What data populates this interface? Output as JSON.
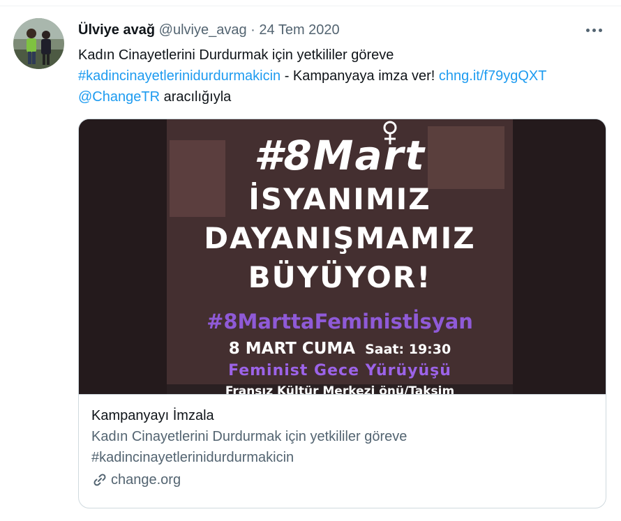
{
  "tweet": {
    "author_name": "Ülviye avağ",
    "handle": "@ulviye_avag",
    "separator": "·",
    "date": "24 Tem 2020",
    "text_line1": "Kadın Cinayetlerini Durdurmak için yetkililer göreve",
    "hashtag": "#kadincinayetlerinidurdurmakicin",
    "text_mid": " - Kampanyaya imza ver! ",
    "short_link": "chng.it/f79ygQXT",
    "mention": "@ChangeTR",
    "text_end": " aracılığıyla"
  },
  "card": {
    "title": "Kampanyayı İmzala",
    "desc_line1": "Kadın Cinayetlerini Durdurmak için yetkililer göreve",
    "desc_line2": "#kadincinayetlerinidurdurmakicin",
    "domain": "change.org"
  },
  "poster": {
    "hashtag": "#8Mart",
    "headline_1": "İSYANIMIZ",
    "headline_2": "DAYANIŞMAMIZ",
    "headline_3": "BÜYÜYOR!",
    "campaign": "#8MarttaFeministİsyan",
    "date": "8 MART CUMA",
    "time": "Saat: 19:30",
    "event": "Feminist Gece Yürüyüşü",
    "venue": "Fransız Kültür Merkezi önü/Taksim"
  },
  "icons": {
    "more": "more-options-icon",
    "link": "link-icon"
  },
  "colors": {
    "link": "#1d9bf0",
    "secondary_text": "#536471",
    "poster_purple": "#8f5ad7"
  }
}
